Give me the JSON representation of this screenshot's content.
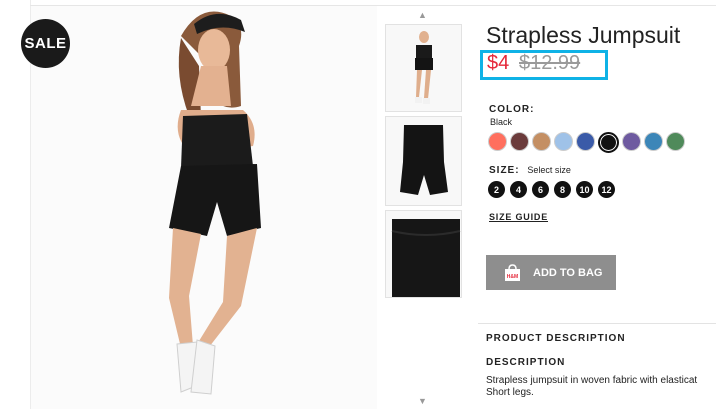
{
  "badge": {
    "sale": "SALE"
  },
  "product": {
    "title": "Strapless Jumpsuit",
    "price_sale": "$4",
    "price_original": "$12.99",
    "color_label": "COLOR:",
    "color_value": "Black",
    "size_label": "SIZE:",
    "size_hint": "Select size",
    "sizes": [
      "2",
      "4",
      "6",
      "8",
      "10",
      "12"
    ],
    "size_guide": "SIZE GUIDE",
    "add_to_bag": "ADD TO BAG",
    "bag_logo": "H&M",
    "product_description_heading": "PRODUCT DESCRIPTION",
    "description_heading": "DESCRIPTION",
    "description_line1": "Strapless jumpsuit in woven fabric with elasticat",
    "description_line2": "Short legs."
  },
  "colors": {
    "price_highlight": "#0fb2e6",
    "sale_price": "#e5283a",
    "swatches": [
      "#ff6f5e",
      "#6b3b3b",
      "#c48f63",
      "#9fc2e8",
      "#3a5aa8",
      "#111111",
      "#6e5aa0",
      "#3c86b8",
      "#4f8a5a"
    ]
  },
  "icons": {
    "thumb_up": "chevron-up-icon",
    "thumb_down": "chevron-down-icon",
    "bag": "shopping-bag-icon"
  }
}
